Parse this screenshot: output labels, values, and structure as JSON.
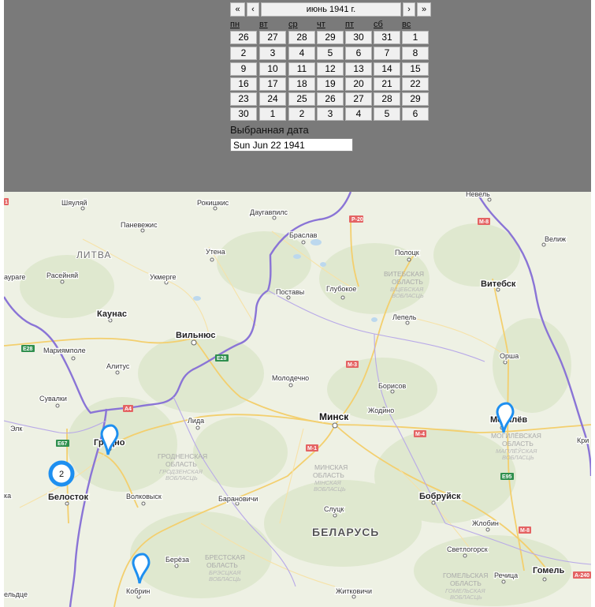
{
  "calendar": {
    "nav": {
      "prev_year": "«",
      "prev_month": "‹",
      "title": "июнь 1941 г.",
      "next_month": "›",
      "next_year": "»"
    },
    "weekdays": [
      "пн",
      "вт",
      "ср",
      "чт",
      "пт",
      "сб",
      "вс"
    ],
    "weeks": [
      [
        "26",
        "27",
        "28",
        "29",
        "30",
        "31",
        "1"
      ],
      [
        "2",
        "3",
        "4",
        "5",
        "6",
        "7",
        "8"
      ],
      [
        "9",
        "10",
        "11",
        "12",
        "13",
        "14",
        "15"
      ],
      [
        "16",
        "17",
        "18",
        "19",
        "20",
        "21",
        "22"
      ],
      [
        "23",
        "24",
        "25",
        "26",
        "27",
        "28",
        "29"
      ],
      [
        "30",
        "1",
        "2",
        "3",
        "4",
        "5",
        "6"
      ]
    ]
  },
  "selected": {
    "label": "Выбранная дата",
    "value": "Sun Jun 22 1941"
  },
  "map": {
    "countries": {
      "lithuania": "ЛИТВА",
      "belarus": "БЕЛАРУСЬ"
    },
    "regions": {
      "vitebsk_ru": "ВИТЕБСКАЯ",
      "vitebsk_ru2": "ОБЛАСТЬ",
      "vitebsk_by": "ВІЦЕБСКАЯ",
      "vitebsk_by2": "ВОБЛАСЦЬ",
      "grodno_ru": "ГРОДНЕНСКАЯ",
      "grodno_ru2": "ОБЛАСТЬ",
      "grodno_by": "ГРОДЗЕНСКАЯ",
      "grodno_by2": "ВОБЛАСЦЬ",
      "minsk_ru": "МИНСКАЯ",
      "minsk_ru2": "ОБЛАСТЬ",
      "minsk_by": "МІНСКАЯ",
      "minsk_by2": "ВОБЛАСЦЬ",
      "mogilev_ru": "МОГИЛЁВСКАЯ",
      "mogilev_ru2": "ОБЛАСТЬ",
      "mogilev_by": "МАГІЛЁЎСКАЯ",
      "mogilev_by2": "ВОБЛАСЦЬ",
      "brest_ru": "БРЕСТСКАЯ",
      "brest_ru2": "ОБЛАСТЬ",
      "brest_by": "БРЭСЦКАЯ",
      "brest_by2": "ВОБЛАСЦЬ",
      "gomel_ru": "ГОМЕЛЬСКАЯ",
      "gomel_ru2": "ОБЛАСТЬ",
      "gomel_by": "ГОМЕЛЬСКАЯ",
      "gomel_by2": "ВОБЛАСЦЬ"
    },
    "cities": {
      "shyaulyay": "Шяуляй",
      "panevezhis": "Паневежис",
      "rokishkis": "Рокишкис",
      "daugavpils": "Даугавпилс",
      "nevel": "Невель",
      "velizh": "Велиж",
      "braslav": "Браслав",
      "polotsk": "Полоцк",
      "utena": "Утена",
      "raseinyai": "Расейняй",
      "ukmerge": "Укмерге",
      "vitebsk": "Витебск",
      "postavy": "Поставы",
      "glubokoe": "Глубокое",
      "kaunas": "Каунас",
      "lepel": "Лепель",
      "vilnius": "Вильнюс",
      "mariyampole": "Мариямполе",
      "orsha": "Орша",
      "alitus": "Алитус",
      "molodechno": "Молодечно",
      "borisov": "Борисов",
      "suvalki": "Сувалки",
      "minsk": "Минск",
      "zhodino": "Жодино",
      "mogilev": "Могилёв",
      "lida": "Лида",
      "grodno": "Гродно",
      "belostok": "Белосток",
      "volkovysk": "Волковыск",
      "baranovichi": "Барановичи",
      "slutsk": "Слуцк",
      "bobruysk": "Бобруйск",
      "zhlobin": "Жлобин",
      "svetlogorsk": "Светлогорск",
      "bereza": "Берёза",
      "kobrin": "Кобрин",
      "rechitsa": "Речица",
      "gomel": "Гомель",
      "zhitkovichi": "Житковичи",
      "elk": "Элк",
      "kri": "Кри",
      "ka": "ка",
      "uragé": "аураге",
      "veldtse": "ельдце"
    },
    "roads": {
      "p20": "P-20",
      "m8_top": "М-8",
      "e28_a": "E28",
      "e28_b": "E28",
      "a4": "A4",
      "m3": "М-3",
      "m1": "М-1",
      "m4": "М-4",
      "e67": "E67",
      "e95": "E95",
      "m8_bot": "М-8",
      "a240": "А-240",
      "r1": "1"
    },
    "cluster": {
      "count": "2"
    },
    "colors": {
      "marker": "#1e8ff0",
      "cluster_ring": "#1e8ff0",
      "border": "#8a74d6",
      "land": "#eef1e4",
      "forest": "#dfe8cf"
    }
  }
}
